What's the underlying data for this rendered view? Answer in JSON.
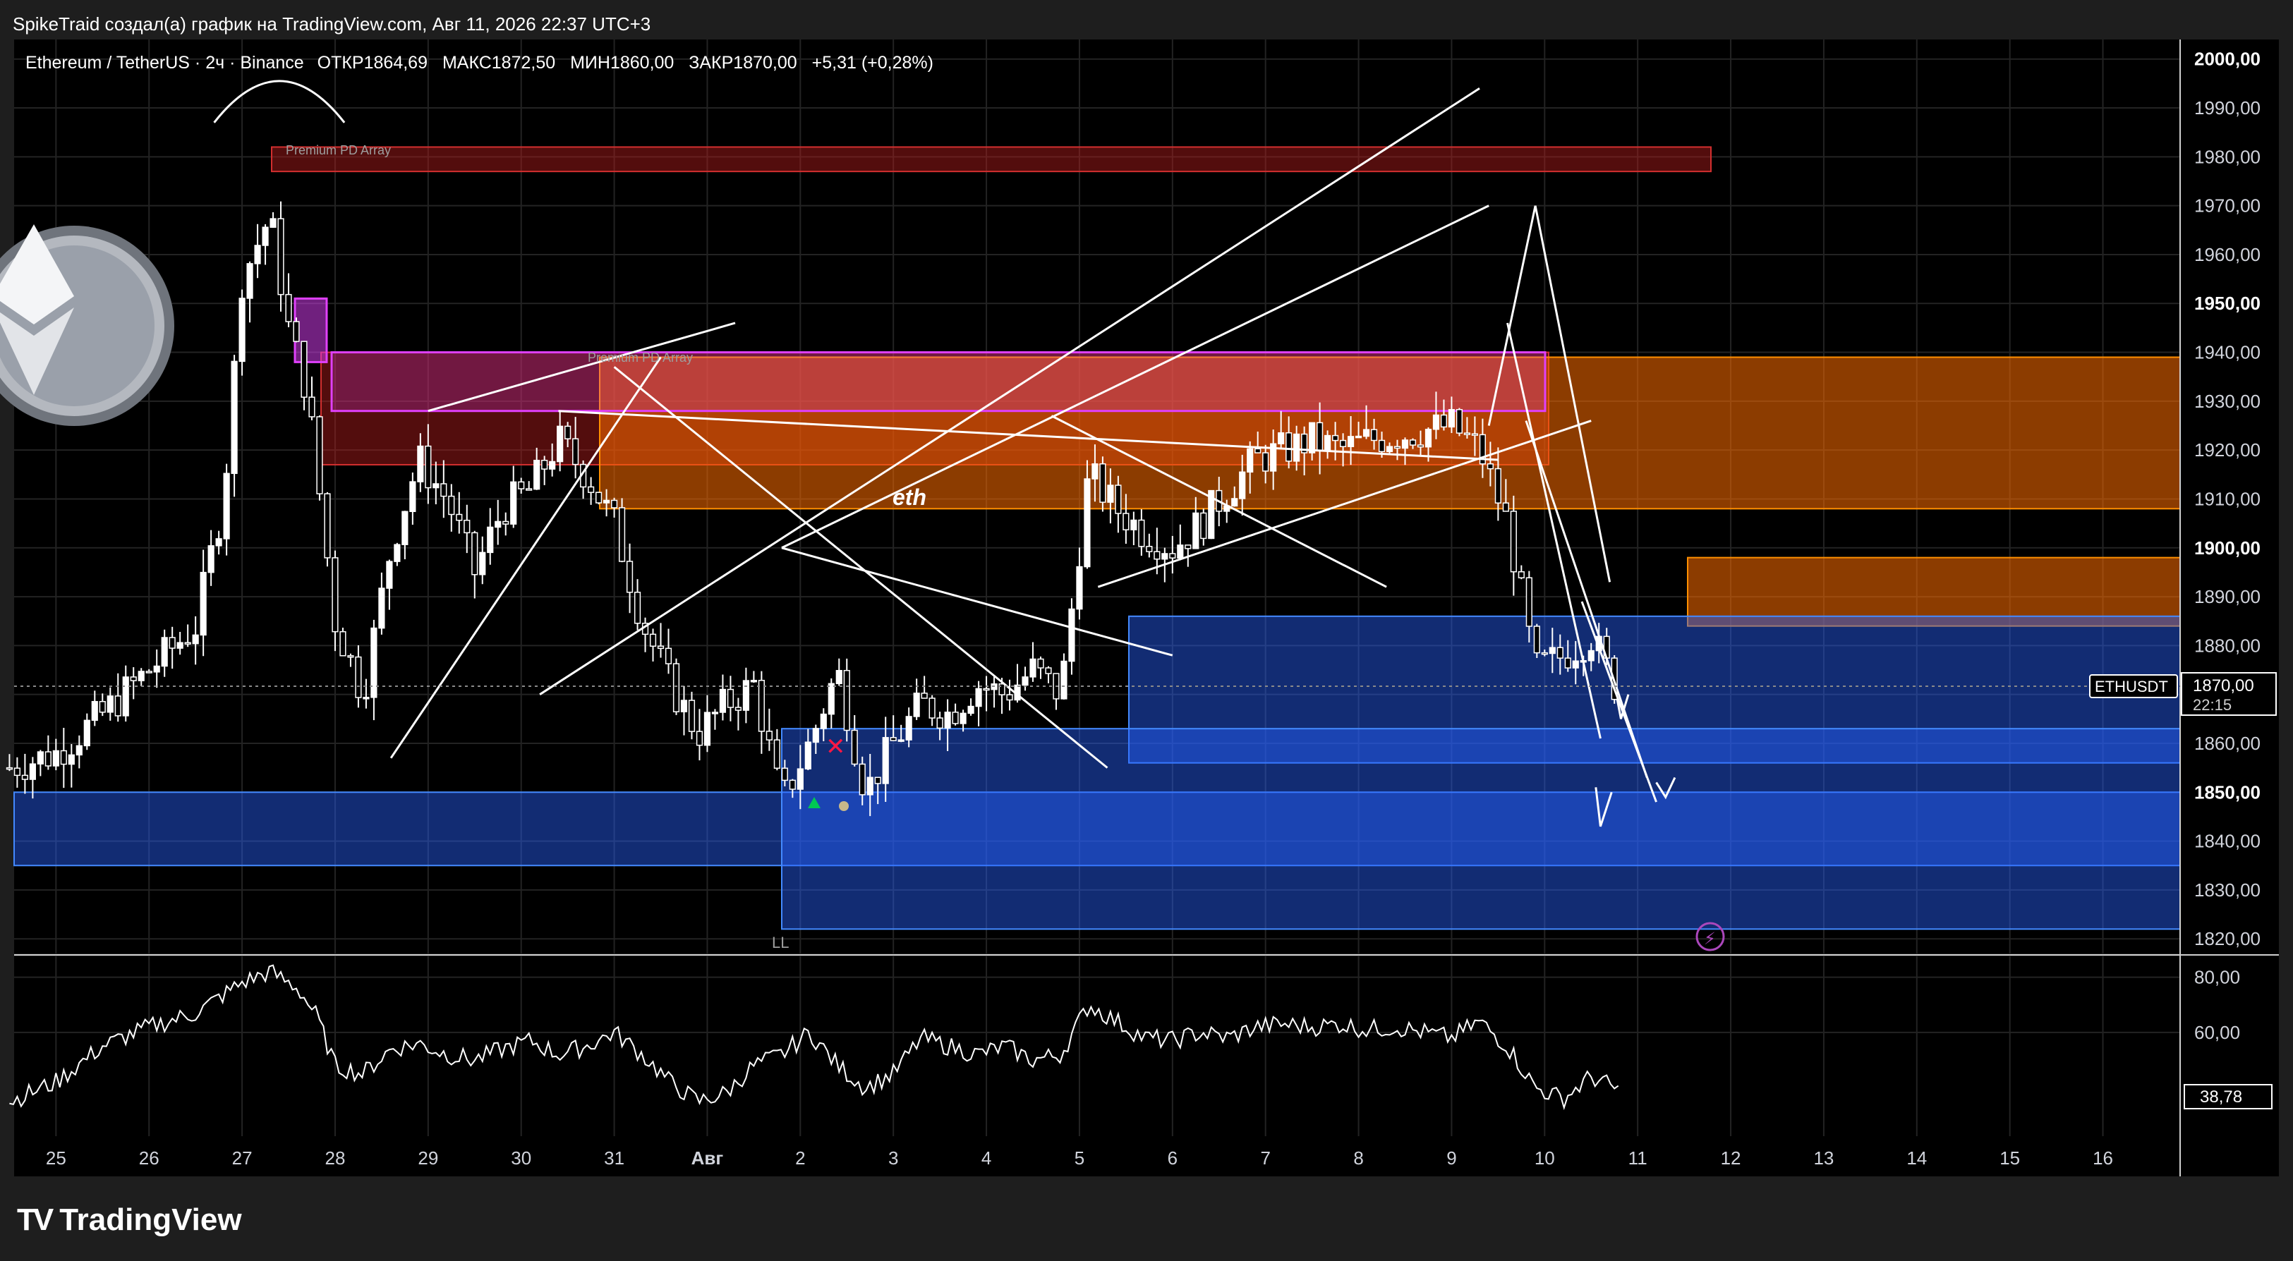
{
  "header": {
    "attribution": "SpikeTraid создал(а) график на TradingView.com, Авг 11, 2026 22:37 UTC+3"
  },
  "legend": {
    "symbol": "Ethereum / TetherUS · 2ч · Binance",
    "open": "ОТКР1864,69",
    "high": "МАКС1872,50",
    "low": "МИН1860,00",
    "close": "ЗАКР1870,00",
    "change": "+5,31 (+0,28%)"
  },
  "annotations": {
    "premium_1": "Premium PD Array",
    "premium_2": "Premium PD Array",
    "eth": "eth",
    "ll": "LL"
  },
  "price_tag": {
    "symbol": "ETHUSDT",
    "price": "1870,00",
    "countdown": "22:15"
  },
  "oscillator": {
    "last_value_label": "38,78"
  },
  "footer": {
    "brand": "TradingView",
    "logo": "TV"
  },
  "colors": {
    "background": "#000000",
    "frame": "#1e1e1e",
    "grid": "#232323",
    "candle": "#ffffff",
    "supply_orange": "#ff6d00",
    "supply_red": "#b71c1c",
    "demand_blue": "#2962ff",
    "magenta": "#e040fb",
    "eth_coin": "#9aa0aa"
  },
  "chart_data": [
    {
      "type": "line",
      "title": "",
      "price_axis": {
        "ticks": [
          1820,
          1830,
          1840,
          1850,
          1860,
          1870,
          1880,
          1890,
          1900,
          1910,
          1920,
          1930,
          1940,
          1950,
          1960,
          1970,
          1980,
          1990,
          2000
        ],
        "tick_labels": [
          "1820,00",
          "1830,00",
          "1840,00",
          "1850,00",
          "1860,00",
          "1870,00",
          "1880,00",
          "1890,00",
          "1900,00",
          "1910,00",
          "1920,00",
          "1930,00",
          "1940,00",
          "1950,00",
          "1960,00",
          "1970,00",
          "1980,00",
          "1990,00",
          "2000,00"
        ],
        "bold_ticks": [
          1850,
          1900,
          1950,
          2000
        ],
        "ylim": [
          1817,
          2004
        ]
      },
      "time_axis": {
        "ticks": [
          25,
          26,
          27,
          28,
          29,
          30,
          31,
          32,
          33,
          34,
          35,
          36,
          37,
          38,
          39,
          40,
          41,
          42,
          43,
          44,
          45,
          46,
          47
        ],
        "tick_labels": [
          "25",
          "26",
          "27",
          "28",
          "29",
          "30",
          "31",
          "Авг",
          "2",
          "3",
          "4",
          "5",
          "6",
          "7",
          "8",
          "9",
          "10",
          "11",
          "12",
          "13",
          "14",
          "15",
          "16"
        ],
        "xlim": [
          24.55,
          47.83
        ],
        "unit": "day index (Авг = 32)"
      },
      "grid": true,
      "series": [
        {
          "x": [
            24.5,
            25.0,
            25.5,
            26.0,
            26.5,
            26.8,
            27.0,
            27.3,
            27.5,
            27.7,
            28.0,
            28.3,
            28.6,
            28.9,
            29.2,
            29.5,
            29.8,
            30.1,
            30.4,
            30.7,
            31.0,
            31.3,
            31.6,
            31.9,
            32.2,
            32.5,
            32.8,
            33.1,
            33.4,
            33.7,
            34.0,
            34.3,
            34.6,
            34.9,
            35.2,
            35.5,
            35.8,
            36.1,
            36.4,
            36.7,
            37.0,
            37.3,
            37.6,
            37.9,
            38.2,
            38.5,
            38.8,
            39.1,
            39.4,
            39.7,
            40.0,
            40.3,
            40.6,
            40.9,
            41.2,
            41.5,
            41.8
          ],
          "y": [
            1855,
            1858,
            1866,
            1875,
            1884,
            1910,
            1955,
            1968,
            1945,
            1932,
            1885,
            1870,
            1900,
            1918,
            1910,
            1895,
            1908,
            1912,
            1922,
            1915,
            1905,
            1885,
            1872,
            1862,
            1868,
            1872,
            1848,
            1860,
            1875,
            1850,
            1860,
            1868,
            1866,
            1872,
            1870,
            1875,
            1870,
            1915,
            1908,
            1903,
            1900,
            1905,
            1912,
            1918,
            1920,
            1922,
            1920,
            1922,
            1923,
            1924,
            1925,
            1920,
            1905,
            1875,
            1878,
            1882,
            1870
          ]
        }
      ],
      "zones": [
        {
          "kind": "supply-red",
          "from": 1977,
          "to": 1982
        },
        {
          "kind": "supply-red",
          "from": 1917,
          "to": 1940
        },
        {
          "kind": "supply-orange",
          "from": 1908,
          "to": 1939
        },
        {
          "kind": "supply-orange",
          "from": 1884,
          "to": 1898
        },
        {
          "kind": "demand-blue",
          "from": 1856,
          "to": 1886
        },
        {
          "kind": "demand-blue",
          "from": 1835,
          "to": 1850
        },
        {
          "kind": "demand-blue",
          "from": 1822,
          "to": 1863
        }
      ]
    },
    {
      "type": "line",
      "title": "",
      "axis": {
        "ticks": [
          60,
          80
        ],
        "tick_labels": [
          "60,00",
          "80,00"
        ],
        "ylim": [
          25,
          85
        ]
      },
      "series": [
        {
          "x": [
            24.5,
            25.0,
            25.5,
            26.0,
            26.5,
            27.0,
            27.3,
            27.6,
            27.8,
            28.0,
            28.3,
            28.6,
            28.9,
            29.2,
            29.5,
            29.8,
            30.1,
            30.4,
            30.7,
            31.0,
            31.3,
            31.6,
            31.9,
            32.2,
            32.5,
            32.8,
            33.1,
            33.4,
            33.7,
            34.0,
            34.3,
            34.6,
            34.9,
            35.2,
            35.5,
            35.8,
            36.1,
            36.4,
            36.7,
            37.0,
            37.3,
            37.6,
            37.9,
            38.2,
            38.5,
            38.8,
            39.1,
            39.4,
            39.7,
            40.0,
            40.3,
            40.6,
            40.9,
            41.2,
            41.5,
            41.8
          ],
          "y": [
            35,
            42,
            55,
            62,
            67,
            78,
            82,
            76,
            66,
            48,
            45,
            54,
            56,
            52,
            50,
            54,
            57,
            52,
            55,
            60,
            52,
            42,
            35,
            38,
            48,
            52,
            60,
            48,
            40,
            45,
            58,
            55,
            52,
            55,
            50,
            52,
            70,
            64,
            58,
            57,
            60,
            58,
            62,
            63,
            62,
            63,
            61,
            62,
            60,
            58,
            64,
            55,
            40,
            36,
            44,
            39
          ]
        }
      ]
    }
  ]
}
